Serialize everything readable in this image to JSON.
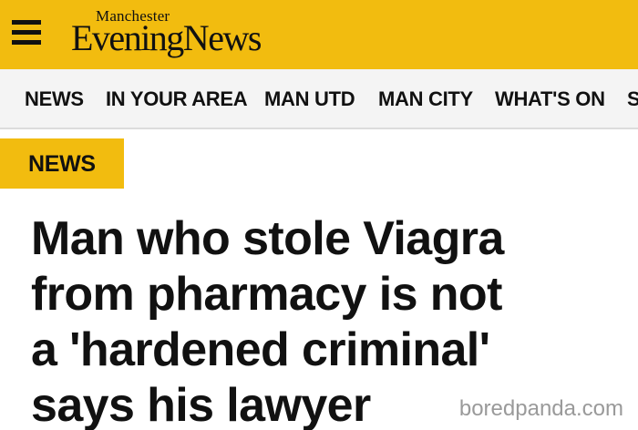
{
  "header": {
    "menu_icon": "hamburger-menu-icon",
    "logo_small": "Manchester",
    "logo_big": "EveningNews",
    "brand_color": "#f2bc0f"
  },
  "nav": {
    "items": [
      {
        "label": "NEWS"
      },
      {
        "label": "IN YOUR AREA"
      },
      {
        "label": "MAN UTD"
      },
      {
        "label": "MAN CITY"
      },
      {
        "label": "WHAT'S ON"
      },
      {
        "label": "S"
      }
    ]
  },
  "article": {
    "section_tag": "NEWS",
    "headline_lines": [
      "Man who stole Viagra",
      "from pharmacy is not",
      "a 'hardened criminal'",
      "says his lawyer"
    ]
  },
  "watermark": {
    "text": "boredpanda.com"
  }
}
